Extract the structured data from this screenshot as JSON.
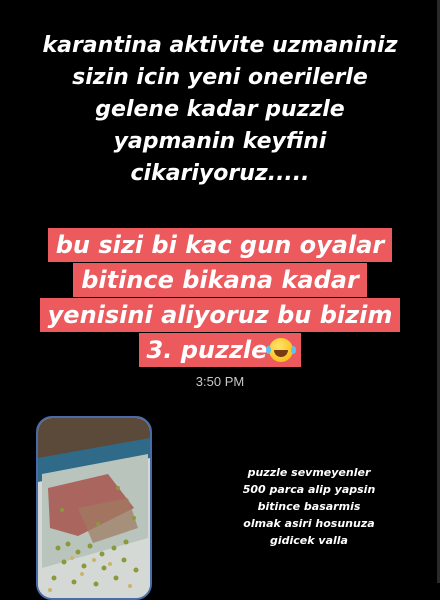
{
  "caption": {
    "lines": [
      "karantina aktivite uzmaniniz",
      "sizin icin yeni onerilerle",
      "gelene kadar puzzle",
      "yapmanin keyfini",
      "cikariyoruz....."
    ]
  },
  "message": {
    "lines": [
      "bu sizi bi kac gun oyalar",
      "bitince bikana kadar",
      "yenisini aliyoruz bu bizim",
      "3. puzzle"
    ],
    "emoji": "face-with-tears-of-joy",
    "highlight_color": "#ec5a5e",
    "timestamp": "3:50 PM"
  },
  "photo": {
    "subject": "puzzle-photo",
    "border_color": "#4a6aa8"
  },
  "side_note": {
    "lines": [
      "puzzle sevmeyenler",
      "500 parca alip yapsin",
      "bitince basarmis",
      "olmak asiri hosunuza",
      "gidicek valla"
    ]
  }
}
